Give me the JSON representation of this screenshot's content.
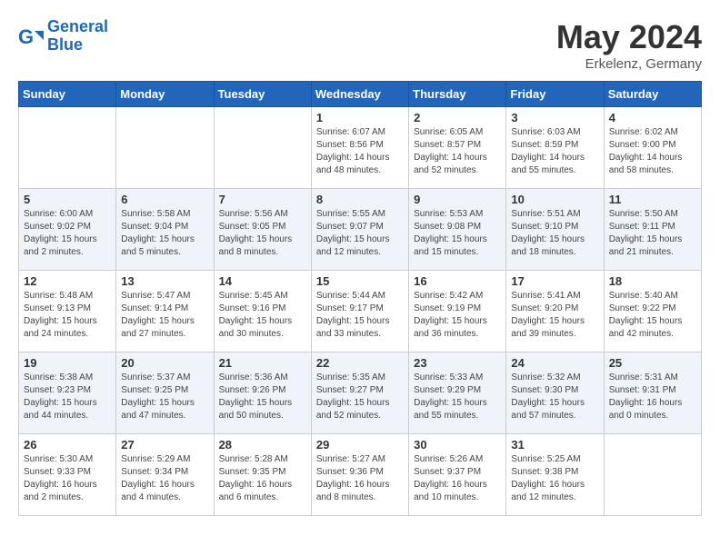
{
  "header": {
    "logo_line1": "General",
    "logo_line2": "Blue",
    "month": "May 2024",
    "location": "Erkelenz, Germany"
  },
  "days_of_week": [
    "Sunday",
    "Monday",
    "Tuesday",
    "Wednesday",
    "Thursday",
    "Friday",
    "Saturday"
  ],
  "weeks": [
    [
      {
        "day": "",
        "info": ""
      },
      {
        "day": "",
        "info": ""
      },
      {
        "day": "",
        "info": ""
      },
      {
        "day": "1",
        "info": "Sunrise: 6:07 AM\nSunset: 8:56 PM\nDaylight: 14 hours\nand 48 minutes."
      },
      {
        "day": "2",
        "info": "Sunrise: 6:05 AM\nSunset: 8:57 PM\nDaylight: 14 hours\nand 52 minutes."
      },
      {
        "day": "3",
        "info": "Sunrise: 6:03 AM\nSunset: 8:59 PM\nDaylight: 14 hours\nand 55 minutes."
      },
      {
        "day": "4",
        "info": "Sunrise: 6:02 AM\nSunset: 9:00 PM\nDaylight: 14 hours\nand 58 minutes."
      }
    ],
    [
      {
        "day": "5",
        "info": "Sunrise: 6:00 AM\nSunset: 9:02 PM\nDaylight: 15 hours\nand 2 minutes."
      },
      {
        "day": "6",
        "info": "Sunrise: 5:58 AM\nSunset: 9:04 PM\nDaylight: 15 hours\nand 5 minutes."
      },
      {
        "day": "7",
        "info": "Sunrise: 5:56 AM\nSunset: 9:05 PM\nDaylight: 15 hours\nand 8 minutes."
      },
      {
        "day": "8",
        "info": "Sunrise: 5:55 AM\nSunset: 9:07 PM\nDaylight: 15 hours\nand 12 minutes."
      },
      {
        "day": "9",
        "info": "Sunrise: 5:53 AM\nSunset: 9:08 PM\nDaylight: 15 hours\nand 15 minutes."
      },
      {
        "day": "10",
        "info": "Sunrise: 5:51 AM\nSunset: 9:10 PM\nDaylight: 15 hours\nand 18 minutes."
      },
      {
        "day": "11",
        "info": "Sunrise: 5:50 AM\nSunset: 9:11 PM\nDaylight: 15 hours\nand 21 minutes."
      }
    ],
    [
      {
        "day": "12",
        "info": "Sunrise: 5:48 AM\nSunset: 9:13 PM\nDaylight: 15 hours\nand 24 minutes."
      },
      {
        "day": "13",
        "info": "Sunrise: 5:47 AM\nSunset: 9:14 PM\nDaylight: 15 hours\nand 27 minutes."
      },
      {
        "day": "14",
        "info": "Sunrise: 5:45 AM\nSunset: 9:16 PM\nDaylight: 15 hours\nand 30 minutes."
      },
      {
        "day": "15",
        "info": "Sunrise: 5:44 AM\nSunset: 9:17 PM\nDaylight: 15 hours\nand 33 minutes."
      },
      {
        "day": "16",
        "info": "Sunrise: 5:42 AM\nSunset: 9:19 PM\nDaylight: 15 hours\nand 36 minutes."
      },
      {
        "day": "17",
        "info": "Sunrise: 5:41 AM\nSunset: 9:20 PM\nDaylight: 15 hours\nand 39 minutes."
      },
      {
        "day": "18",
        "info": "Sunrise: 5:40 AM\nSunset: 9:22 PM\nDaylight: 15 hours\nand 42 minutes."
      }
    ],
    [
      {
        "day": "19",
        "info": "Sunrise: 5:38 AM\nSunset: 9:23 PM\nDaylight: 15 hours\nand 44 minutes."
      },
      {
        "day": "20",
        "info": "Sunrise: 5:37 AM\nSunset: 9:25 PM\nDaylight: 15 hours\nand 47 minutes."
      },
      {
        "day": "21",
        "info": "Sunrise: 5:36 AM\nSunset: 9:26 PM\nDaylight: 15 hours\nand 50 minutes."
      },
      {
        "day": "22",
        "info": "Sunrise: 5:35 AM\nSunset: 9:27 PM\nDaylight: 15 hours\nand 52 minutes."
      },
      {
        "day": "23",
        "info": "Sunrise: 5:33 AM\nSunset: 9:29 PM\nDaylight: 15 hours\nand 55 minutes."
      },
      {
        "day": "24",
        "info": "Sunrise: 5:32 AM\nSunset: 9:30 PM\nDaylight: 15 hours\nand 57 minutes."
      },
      {
        "day": "25",
        "info": "Sunrise: 5:31 AM\nSunset: 9:31 PM\nDaylight: 16 hours\nand 0 minutes."
      }
    ],
    [
      {
        "day": "26",
        "info": "Sunrise: 5:30 AM\nSunset: 9:33 PM\nDaylight: 16 hours\nand 2 minutes."
      },
      {
        "day": "27",
        "info": "Sunrise: 5:29 AM\nSunset: 9:34 PM\nDaylight: 16 hours\nand 4 minutes."
      },
      {
        "day": "28",
        "info": "Sunrise: 5:28 AM\nSunset: 9:35 PM\nDaylight: 16 hours\nand 6 minutes."
      },
      {
        "day": "29",
        "info": "Sunrise: 5:27 AM\nSunset: 9:36 PM\nDaylight: 16 hours\nand 8 minutes."
      },
      {
        "day": "30",
        "info": "Sunrise: 5:26 AM\nSunset: 9:37 PM\nDaylight: 16 hours\nand 10 minutes."
      },
      {
        "day": "31",
        "info": "Sunrise: 5:25 AM\nSunset: 9:38 PM\nDaylight: 16 hours\nand 12 minutes."
      },
      {
        "day": "",
        "info": ""
      }
    ]
  ]
}
